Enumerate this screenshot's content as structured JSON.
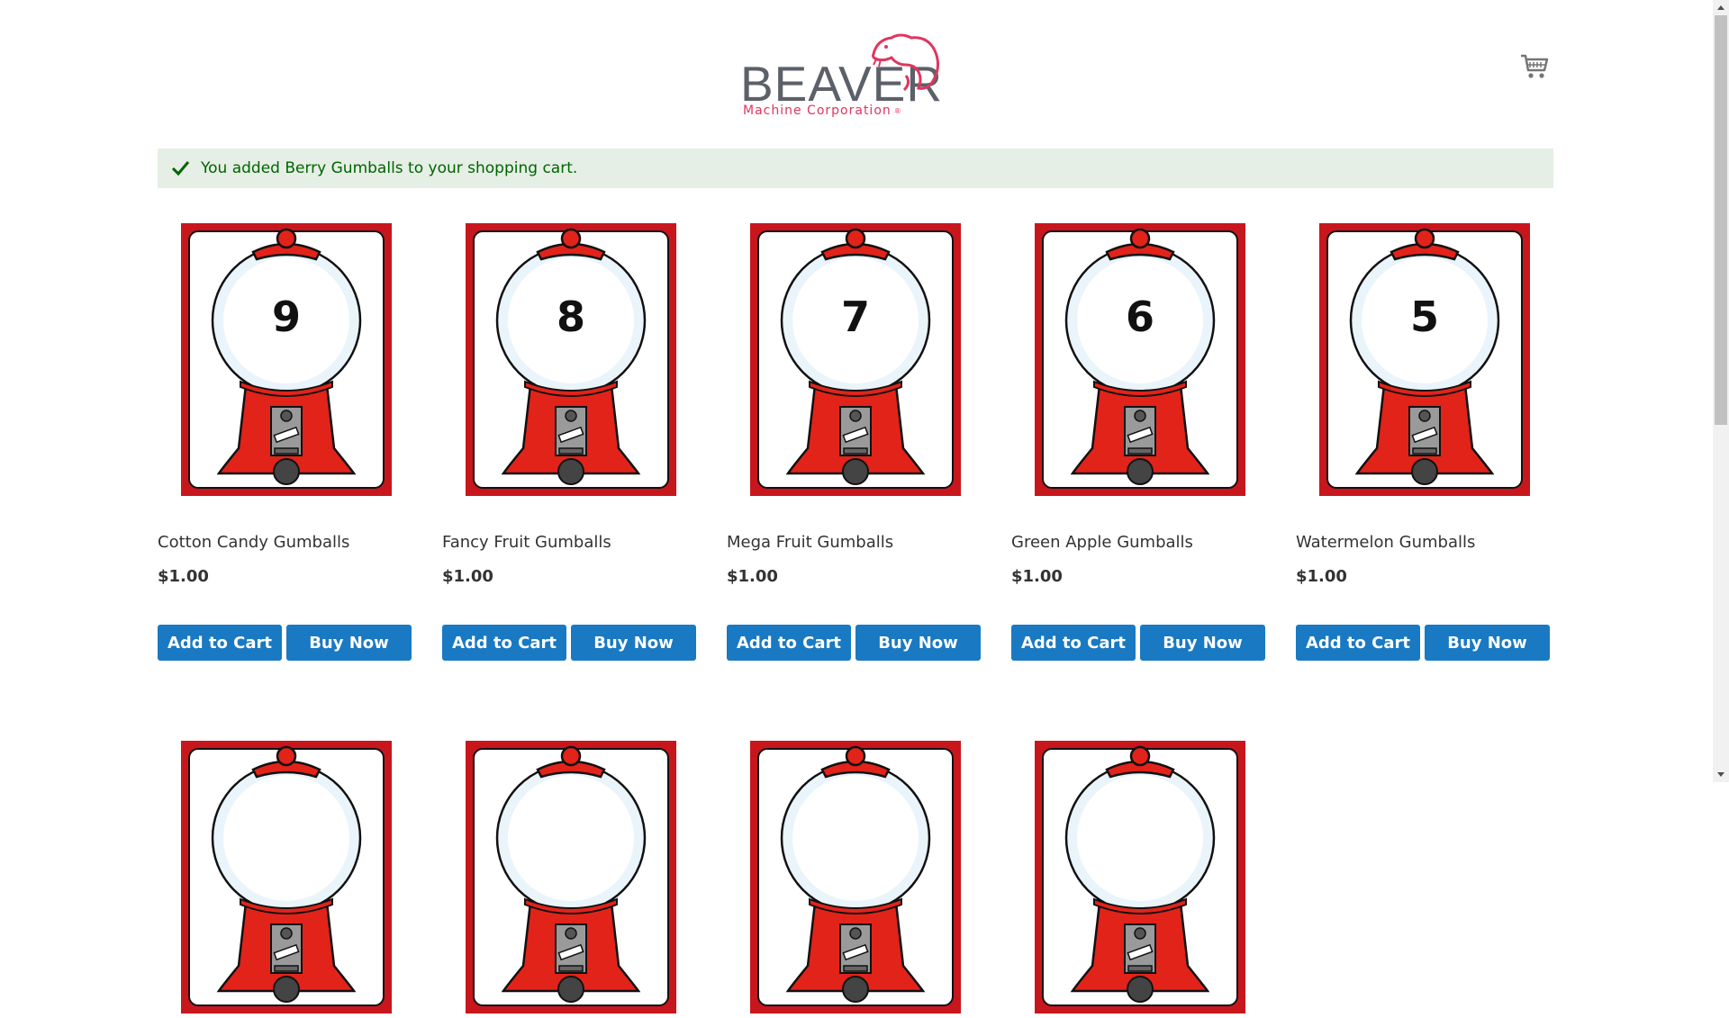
{
  "header": {
    "logo_main": "BEAVER",
    "logo_sub": "Machine Corporation",
    "logo_reg": "®",
    "cart_icon": "shopping-cart-icon"
  },
  "message": {
    "icon": "checkmark-icon",
    "text": "You added Berry Gumballs to your shopping cart."
  },
  "products": [
    {
      "name": "Cotton Candy Gumballs",
      "price": "$1.00",
      "number": "9",
      "add_label": "Add to Cart",
      "buy_label": "Buy Now"
    },
    {
      "name": "Fancy Fruit Gumballs",
      "price": "$1.00",
      "number": "8",
      "add_label": "Add to Cart",
      "buy_label": "Buy Now"
    },
    {
      "name": "Mega Fruit Gumballs",
      "price": "$1.00",
      "number": "7",
      "add_label": "Add to Cart",
      "buy_label": "Buy Now"
    },
    {
      "name": "Green Apple Gumballs",
      "price": "$1.00",
      "number": "6",
      "add_label": "Add to Cart",
      "buy_label": "Buy Now"
    },
    {
      "name": "Watermelon Gumballs",
      "price": "$1.00",
      "number": "5",
      "add_label": "Add to Cart",
      "buy_label": "Buy Now"
    }
  ],
  "colors": {
    "button": "#1979c3",
    "message_bg": "#e5efe5",
    "message_text": "#006400",
    "logo_red": "#e0355f",
    "gumball_red": "#e2231a"
  }
}
